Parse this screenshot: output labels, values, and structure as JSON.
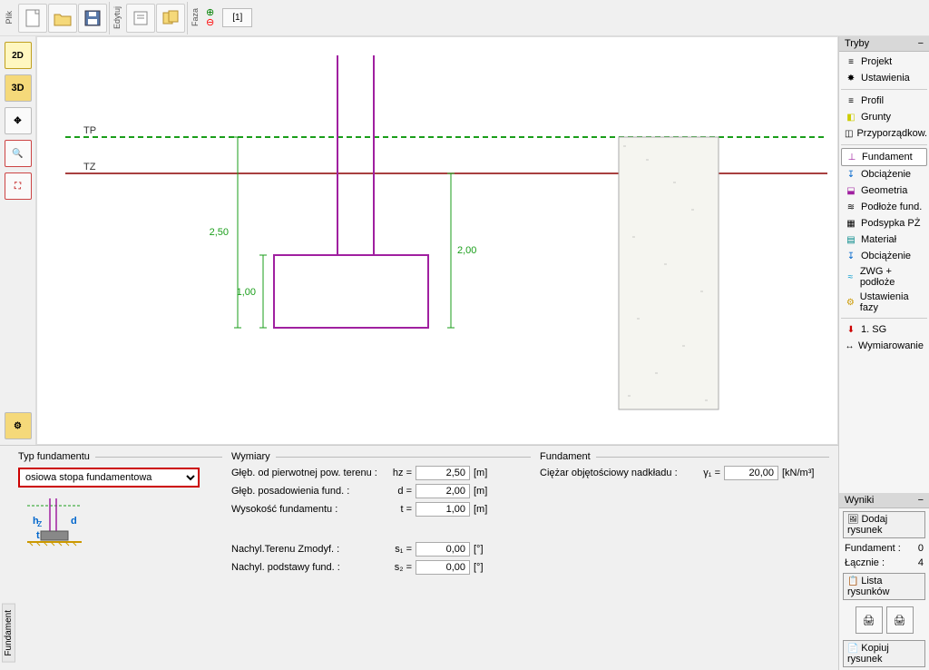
{
  "toolbar": {
    "group_plik": "Plik",
    "group_edytuj": "Edytuj",
    "group_faza": "Faza",
    "tab1": "[1]"
  },
  "left_tools": {
    "v2d": "2D",
    "v3d": "3D"
  },
  "canvas": {
    "label_tp": "TP",
    "label_tz": "TZ",
    "dim_250": "2,50",
    "dim_100": "1,00",
    "dim_200": "2,00"
  },
  "right": {
    "tryby": "Tryby",
    "items1": [
      {
        "icon": "≡",
        "label": "Projekt"
      },
      {
        "icon": "✸",
        "label": "Ustawienia"
      }
    ],
    "items2": [
      {
        "icon": "≡",
        "label": "Profil"
      },
      {
        "icon": "◧",
        "label": "Grunty"
      },
      {
        "icon": "◫",
        "label": "Przyporządkow."
      }
    ],
    "items3": [
      {
        "icon": "⊥",
        "label": "Fundament",
        "sel": true
      },
      {
        "icon": "↧",
        "label": "Obciążenie"
      },
      {
        "icon": "⬓",
        "label": "Geometria"
      },
      {
        "icon": "≋",
        "label": "Podłoże fund."
      },
      {
        "icon": "▦",
        "label": "Podsypka PŻ"
      },
      {
        "icon": "▤",
        "label": "Materiał"
      },
      {
        "icon": "↧",
        "label": "Obciążenie"
      },
      {
        "icon": "≈",
        "label": "ZWG + podłoże"
      },
      {
        "icon": "⚙",
        "label": "Ustawienia fazy"
      }
    ],
    "items4": [
      {
        "icon": "⬇",
        "label": "1. SG"
      },
      {
        "icon": "↔",
        "label": "Wymiarowanie"
      }
    ],
    "wyniki": "Wyniki",
    "btn_dodaj": "Dodaj rysunek",
    "row_fund": "Fundament :",
    "row_fund_v": "0",
    "row_lacz": "Łącznie :",
    "row_lacz_v": "4",
    "btn_lista": "Lista rysunków",
    "btn_kopiuj": "Kopiuj rysunek"
  },
  "bottom": {
    "side_tab": "Fundament",
    "typ_legend": "Typ fundamentu",
    "typ_value": "osiowa stopa fundamentowa",
    "wym_legend": "Wymiary",
    "fund_legend": "Fundament",
    "rows": {
      "r1": {
        "lbl": "Głęb. od pierwotnej pow. terenu :",
        "sym": "hz =",
        "val": "2,50",
        "unit": "[m]"
      },
      "r2": {
        "lbl": "Głęb. posadowienia fund. :",
        "sym": "d =",
        "val": "2,00",
        "unit": "[m]"
      },
      "r3": {
        "lbl": "Wysokość fundamentu :",
        "sym": "t =",
        "val": "1,00",
        "unit": "[m]"
      },
      "r4": {
        "lbl": "Nachyl.Terenu Zmodyf. :",
        "sym": "s₁ =",
        "val": "0,00",
        "unit": "[°]"
      },
      "r5": {
        "lbl": "Nachyl. podstawy fund. :",
        "sym": "s₂ =",
        "val": "0,00",
        "unit": "[°]"
      }
    },
    "fund_row": {
      "lbl": "Ciężar objętościowy nadkładu :",
      "sym": "γ₁ =",
      "val": "20,00",
      "unit": "[kN/m³]"
    },
    "diagram": {
      "hz": "hz",
      "d": "d",
      "t": "t"
    }
  }
}
